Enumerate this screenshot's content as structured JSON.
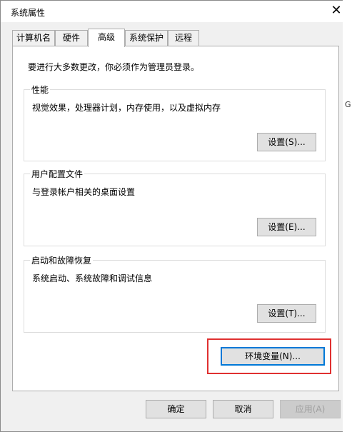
{
  "window": {
    "title": "系统属性",
    "close_symbol": "✕"
  },
  "tabs": [
    {
      "label": "计算机名",
      "active": false
    },
    {
      "label": "硬件",
      "active": false
    },
    {
      "label": "高级",
      "active": true
    },
    {
      "label": "系统保护",
      "active": false
    },
    {
      "label": "远程",
      "active": false
    }
  ],
  "advanced": {
    "notice": "要进行大多数更改，你必须作为管理员登录。",
    "performance": {
      "title": "性能",
      "description": "视觉效果，处理器计划，内存使用，以及虚拟内存",
      "button": "设置(S)..."
    },
    "user_profiles": {
      "title": "用户配置文件",
      "description": "与登录帐户相关的桌面设置",
      "button": "设置(E)..."
    },
    "startup_recovery": {
      "title": "启动和故障恢复",
      "description": "系统启动、系统故障和调试信息",
      "button": "设置(T)..."
    },
    "env_button": "环境变量(N)..."
  },
  "footer": {
    "ok": "确定",
    "cancel": "取消",
    "apply": "应用(A)"
  },
  "background": {
    "edge_char": "G"
  },
  "colors": {
    "highlight": "#e03030",
    "focus": "#0078d7"
  }
}
